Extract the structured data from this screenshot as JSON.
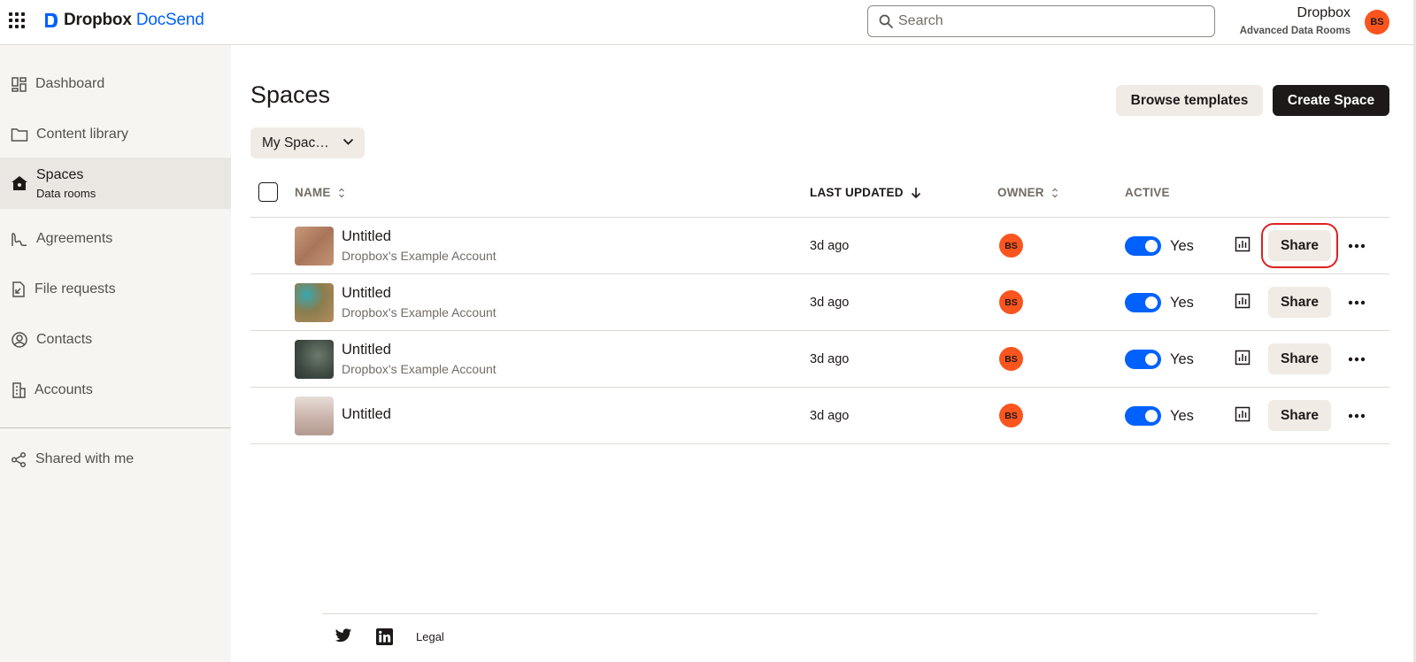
{
  "header": {
    "logo_brand": "Dropbox",
    "logo_product": "DocSend",
    "search_placeholder": "Search",
    "account_name": "Dropbox",
    "account_plan": "Advanced Data Rooms",
    "avatar_initials": "BS"
  },
  "sidebar": {
    "items": [
      {
        "label": "Dashboard",
        "icon": "dashboard-icon"
      },
      {
        "label": "Content library",
        "icon": "folder-icon"
      },
      {
        "label": "Spaces",
        "sub": "Data rooms",
        "icon": "home-lock-icon",
        "active": true
      },
      {
        "label": "Agreements",
        "icon": "signature-icon"
      },
      {
        "label": "File requests",
        "icon": "file-request-icon"
      },
      {
        "label": "Contacts",
        "icon": "contact-icon"
      },
      {
        "label": "Accounts",
        "icon": "building-icon"
      },
      {
        "label": "Shared with me",
        "icon": "share-icon"
      }
    ]
  },
  "main": {
    "title": "Spaces",
    "browse_templates": "Browse templates",
    "create_space": "Create Space",
    "filter_label": "My Spac…",
    "columns": {
      "name": "NAME",
      "last_updated": "LAST UPDATED",
      "owner": "OWNER",
      "active": "ACTIVE"
    },
    "rows": [
      {
        "title": "Untitled",
        "subtitle": "Dropbox's Example Account",
        "updated": "3d ago",
        "owner": "BS",
        "active": "Yes",
        "action": "Share",
        "thumb": "#b98a6a"
      },
      {
        "title": "Untitled",
        "subtitle": "Dropbox's Example Account",
        "updated": "3d ago",
        "owner": "BS",
        "active": "Yes",
        "action": "Share",
        "thumb": "#8f8a55"
      },
      {
        "title": "Untitled",
        "subtitle": "Dropbox's Example Account",
        "updated": "3d ago",
        "owner": "BS",
        "active": "Yes",
        "action": "Share",
        "thumb": "#4e5a50"
      },
      {
        "title": "Untitled",
        "subtitle": "",
        "updated": "3d ago",
        "owner": "BS",
        "active": "Yes",
        "action": "Share",
        "thumb": "#c9b6ad"
      }
    ]
  },
  "footer": {
    "legal": "Legal"
  },
  "colors": {
    "accent": "#0061fe",
    "avatar": "#fa551e",
    "dark_button": "#1e1919",
    "light_button": "#f0ebe5"
  }
}
